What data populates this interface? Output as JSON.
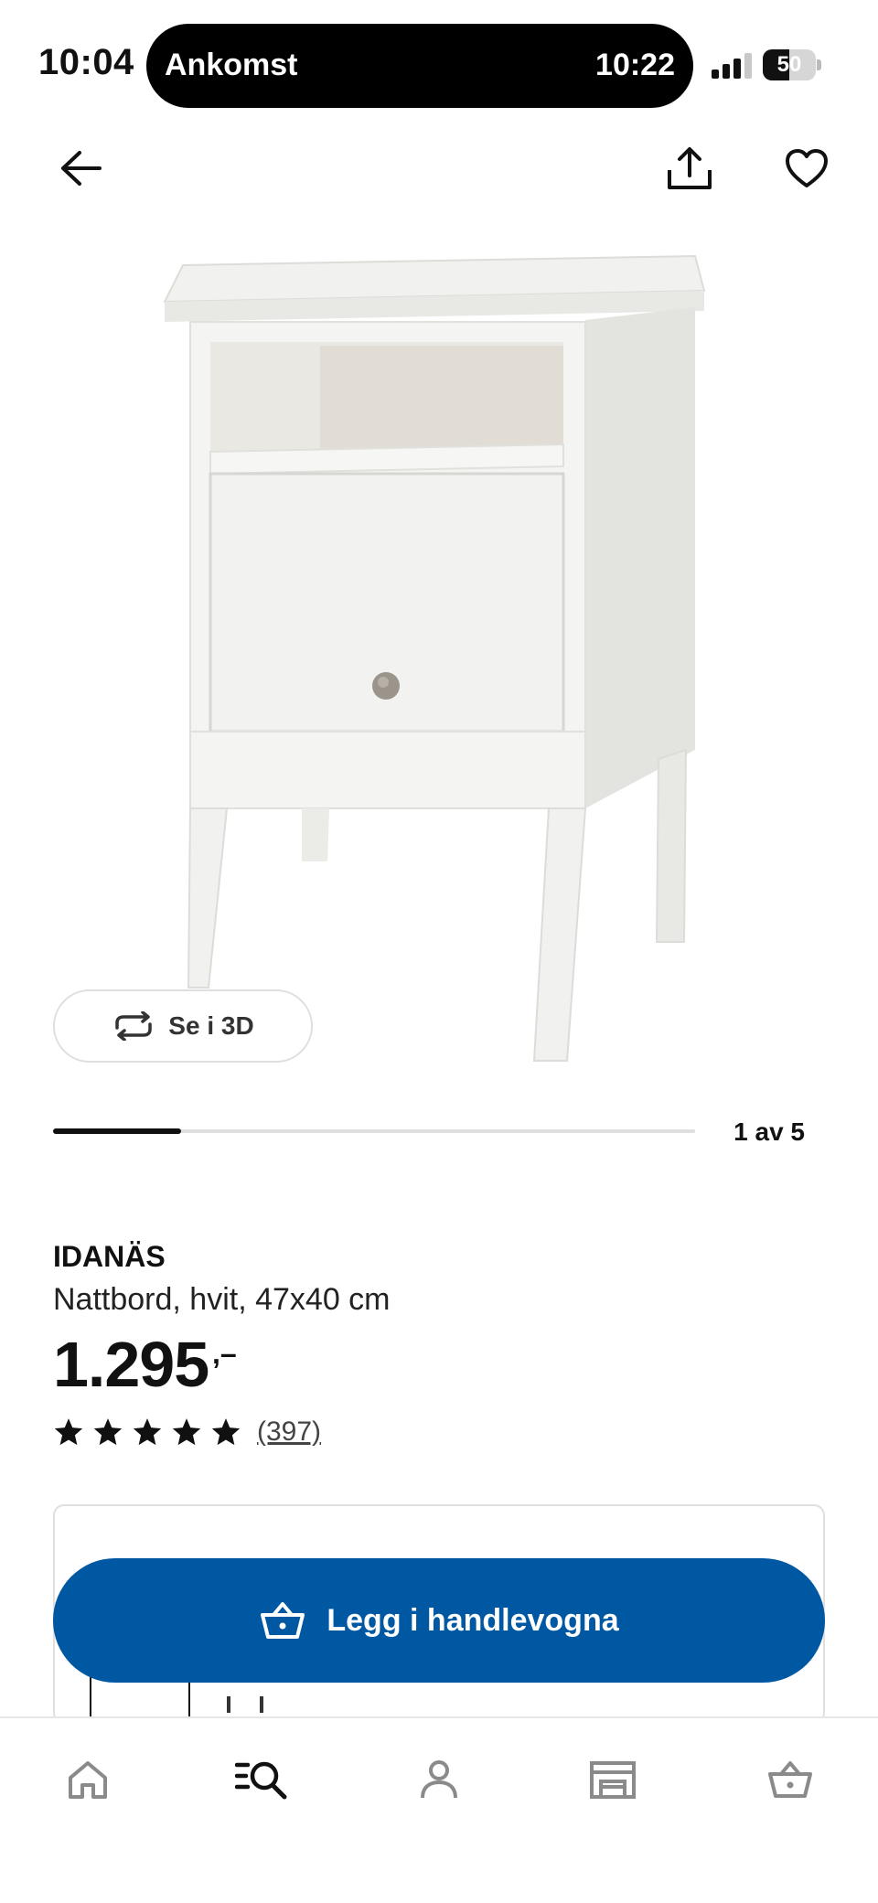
{
  "status_bar": {
    "time": "10:04",
    "live_activity_label": "Ankomst",
    "live_activity_time": "10:22",
    "battery_level": "50",
    "battery_fraction": 0.5
  },
  "top_bar": {
    "back_icon": "arrow-left-icon",
    "share_icon": "share-icon",
    "favorite_icon": "heart-icon"
  },
  "gallery": {
    "view_3d_label": "Se i 3D",
    "counter": "1 av 5",
    "current_image": 1,
    "total_images": 5
  },
  "product": {
    "name": "IDANÄS",
    "description": "Nattbord, hvit, 47x40 cm",
    "price": "1.295",
    "price_suffix": ",–",
    "rating": 5,
    "review_count": "(397)"
  },
  "cart": {
    "label": "Legg i handlevogna",
    "icon": "basket-icon"
  },
  "bottom_nav": {
    "items": [
      "home-icon",
      "search-list-icon",
      "profile-icon",
      "store-icon",
      "basket-icon"
    ],
    "active": "search-list-icon"
  },
  "colors": {
    "primary": "#0058a3",
    "text": "#111111",
    "divider": "#dfdfdf"
  }
}
